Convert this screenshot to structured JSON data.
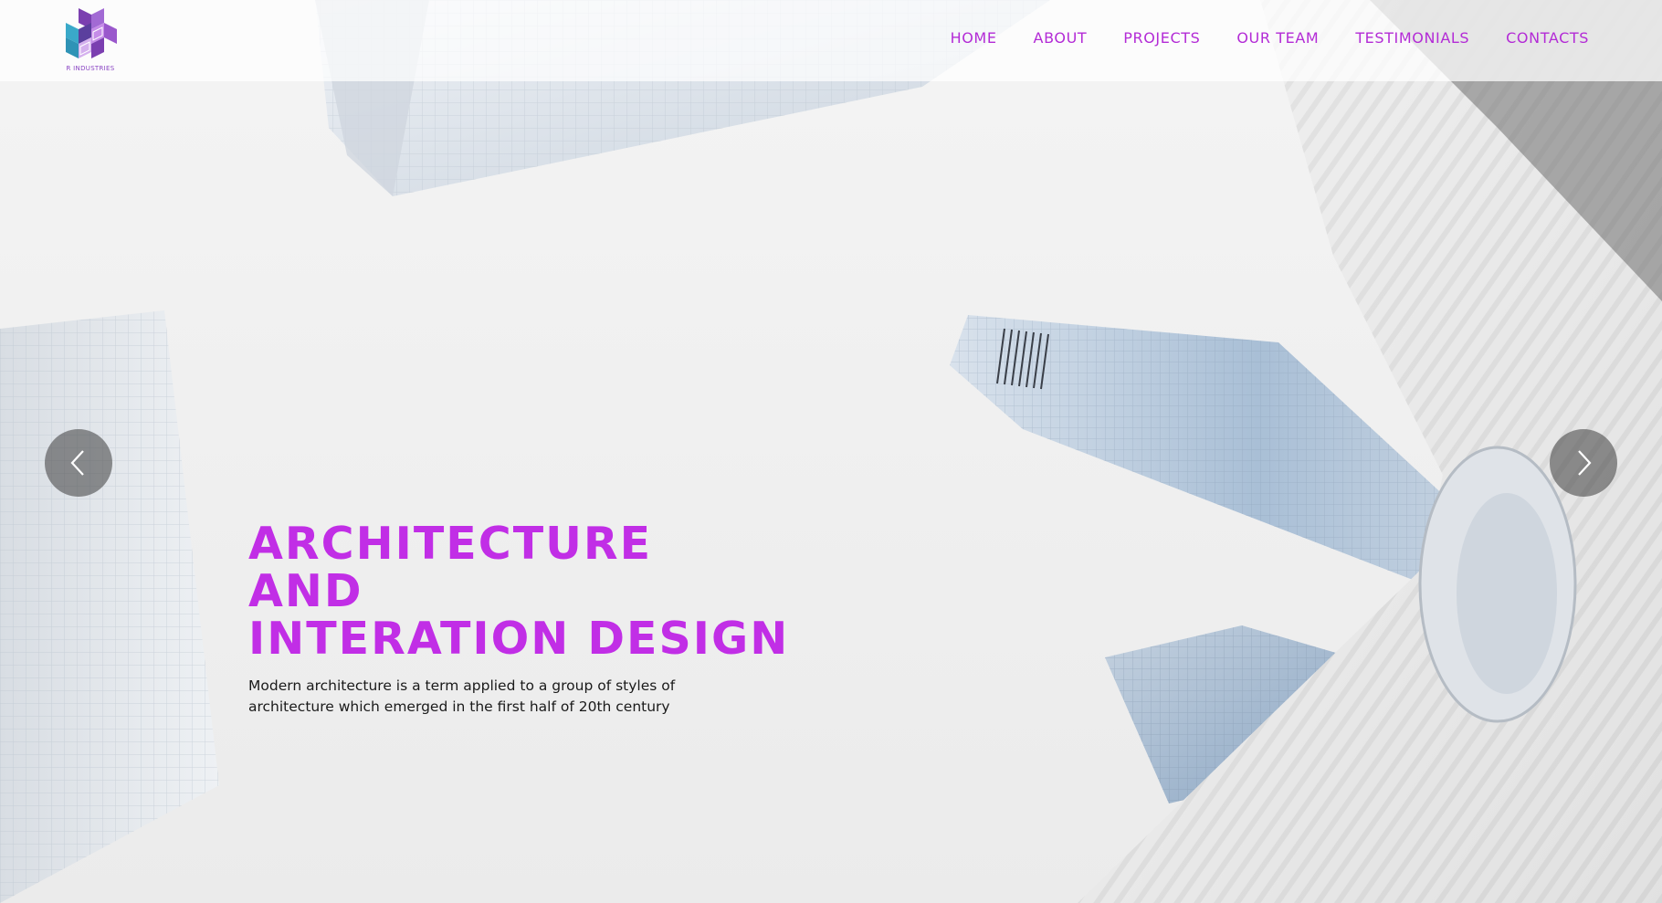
{
  "brand": {
    "name": "R INDUSTRIES",
    "accent_color": "#c12ee6",
    "nav_color": "#b32bd6"
  },
  "nav": {
    "items": [
      {
        "label": "HOME"
      },
      {
        "label": "ABOUT"
      },
      {
        "label": "PROJECTS"
      },
      {
        "label": "OUR TEAM"
      },
      {
        "label": "TESTIMONIALS"
      },
      {
        "label": "CONTACTS"
      }
    ]
  },
  "slider": {
    "prev_icon": "chevron-left-icon",
    "next_icon": "chevron-right-icon"
  },
  "hero": {
    "title_lines": [
      "ARCHITECTURE",
      "AND",
      "INTERATION DESIGN"
    ],
    "description": "Modern architecture is a term applied to a group of styles of architecture which emerged in the first half of 20th century"
  }
}
